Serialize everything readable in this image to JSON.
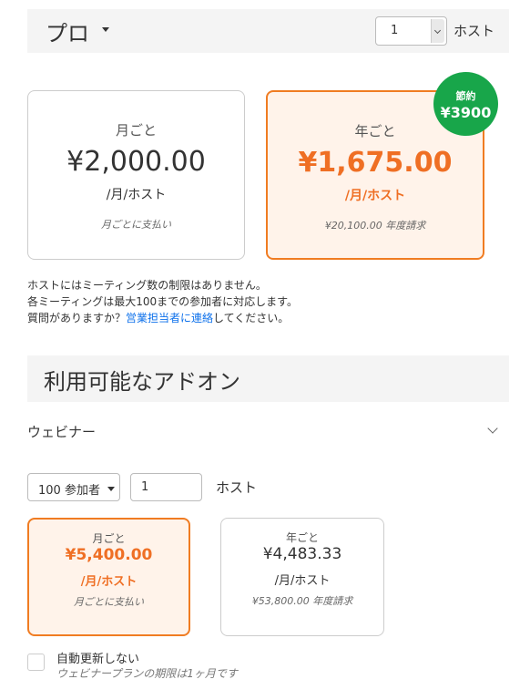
{
  "plan": {
    "title": "プロ",
    "host_count": "1",
    "host_unit": "ホスト"
  },
  "pricing": {
    "monthly": {
      "period": "月ごと",
      "price": "¥2,000.00",
      "unit": "/月/ホスト",
      "note": "月ごとに支払い"
    },
    "yearly": {
      "period": "年ごと",
      "price": "¥1,675.00",
      "unit": "/月/ホスト",
      "note": "¥20,100.00 年度請求"
    },
    "savings": {
      "label": "節約",
      "amount": "¥3900"
    }
  },
  "info": {
    "line1": "ホストにはミーティング数の制限はありません。",
    "line2": "各ミーティングは最大100までの参加者に対応します。",
    "line3_prefix": "質問がありますか？",
    "link_text": "営業担当者に連絡",
    "line3_suffix": "してください。"
  },
  "addons": {
    "title": "利用可能なアドオン",
    "webinar": {
      "title": "ウェビナー",
      "participants": "100 参加者",
      "quantity": "1",
      "host_unit": "ホスト",
      "monthly": {
        "period": "月ごと",
        "price": "¥5,400.00",
        "unit": "/月/ホスト",
        "note": "月ごとに支払い"
      },
      "yearly": {
        "period": "年ごと",
        "price": "¥4,483.33",
        "unit": "/月/ホスト",
        "note": "¥53,800.00 年度請求"
      },
      "auto_renew_label": "自動更新しない",
      "auto_renew_sub": "ウェビナープランの期限は1ヶ月です"
    }
  },
  "colors": {
    "accent_orange": "#ef6f24",
    "badge_green": "#18a64a",
    "link_blue": "#0e71eb",
    "header_bg": "#f4f4f4"
  },
  "icons": {
    "plan_dropdown": "caret-down-icon",
    "host_select": "chevron-down-icon",
    "expand": "chevron-down-icon"
  }
}
